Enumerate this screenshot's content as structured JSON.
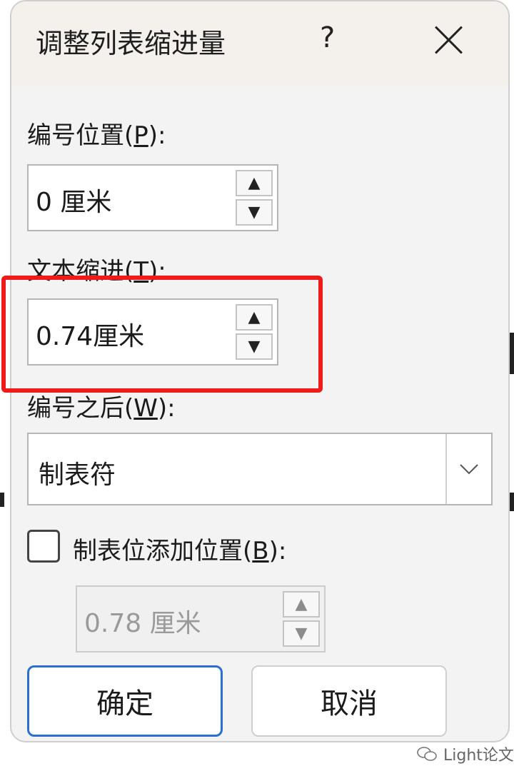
{
  "dialog": {
    "title": "调整列表缩进量",
    "help_label": "?",
    "number_position": {
      "label": "编号位置(",
      "accel": "P",
      "suffix": "):",
      "value": "0 厘米"
    },
    "text_indent": {
      "label": "文本缩进(",
      "accel": "T",
      "suffix": "):",
      "value": "0.74厘米"
    },
    "follow_number": {
      "label": "编号之后(",
      "accel": "W",
      "suffix": "):",
      "value": "制表符"
    },
    "tab_stop": {
      "label": "制表位添加位置(",
      "accel": "B",
      "suffix": "):",
      "value": "0.78 厘米",
      "checked": false
    },
    "ok_label": "确定",
    "cancel_label": "取消"
  },
  "watermark": {
    "text": "Light论文"
  },
  "colors": {
    "highlight": "#ef1b1b",
    "accent": "#2b6fd0"
  },
  "icons": {
    "close": "close-icon",
    "up": "arrow-up-icon",
    "down": "arrow-down-icon",
    "dropdown": "chevron-down-icon",
    "watermark": "wechat-icon"
  }
}
